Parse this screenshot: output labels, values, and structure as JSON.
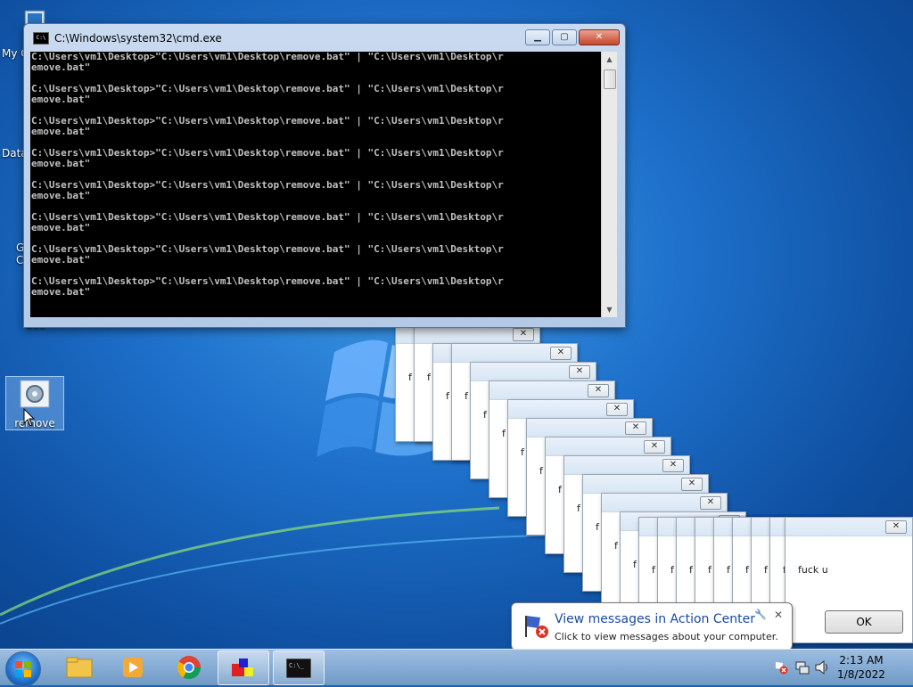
{
  "cmd_window": {
    "title": "C:\\Windows\\system32\\cmd.exe",
    "lines": [
      "C:\\Users\\vm1\\Desktop>\"C:\\Users\\vm1\\Desktop\\remove.bat\" | \"C:\\Users\\vm1\\Desktop\\r",
      "emove.bat\"",
      "",
      "C:\\Users\\vm1\\Desktop>\"C:\\Users\\vm1\\Desktop\\remove.bat\" | \"C:\\Users\\vm1\\Desktop\\r",
      "emove.bat\"",
      "",
      "C:\\Users\\vm1\\Desktop>\"C:\\Users\\vm1\\Desktop\\remove.bat\" | \"C:\\Users\\vm1\\Desktop\\r",
      "emove.bat\"",
      "",
      "C:\\Users\\vm1\\Desktop>\"C:\\Users\\vm1\\Desktop\\remove.bat\" | \"C:\\Users\\vm1\\Desktop\\r",
      "emove.bat\"",
      "",
      "C:\\Users\\vm1\\Desktop>\"C:\\Users\\vm1\\Desktop\\remove.bat\" | \"C:\\Users\\vm1\\Desktop\\r",
      "emove.bat\"",
      "",
      "C:\\Users\\vm1\\Desktop>\"C:\\Users\\vm1\\Desktop\\remove.bat\" | \"C:\\Users\\vm1\\Desktop\\r",
      "emove.bat\"",
      "",
      "C:\\Users\\vm1\\Desktop>\"C:\\Users\\vm1\\Desktop\\remove.bat\" | \"C:\\Users\\vm1\\Desktop\\r",
      "emove.bat\"",
      "",
      "C:\\Users\\vm1\\Desktop>\"C:\\Users\\vm1\\Desktop\\remove.bat\" | \"C:\\Users\\vm1\\Desktop\\r",
      "emove.bat\""
    ]
  },
  "desktop_icons": {
    "my_computer": "My C",
    "data": "Data",
    "g": "G",
    "c": "C",
    "dee": "dee",
    "remove": "remove"
  },
  "message_box": {
    "message": "fuck u",
    "partial_message": "f",
    "ok_label": "OK",
    "close_label": "✕"
  },
  "notification": {
    "title": "View messages in Action Center",
    "body": "Click to view messages about your computer."
  },
  "clock": {
    "time": "2:13 AM",
    "date": "1/8/2022"
  }
}
